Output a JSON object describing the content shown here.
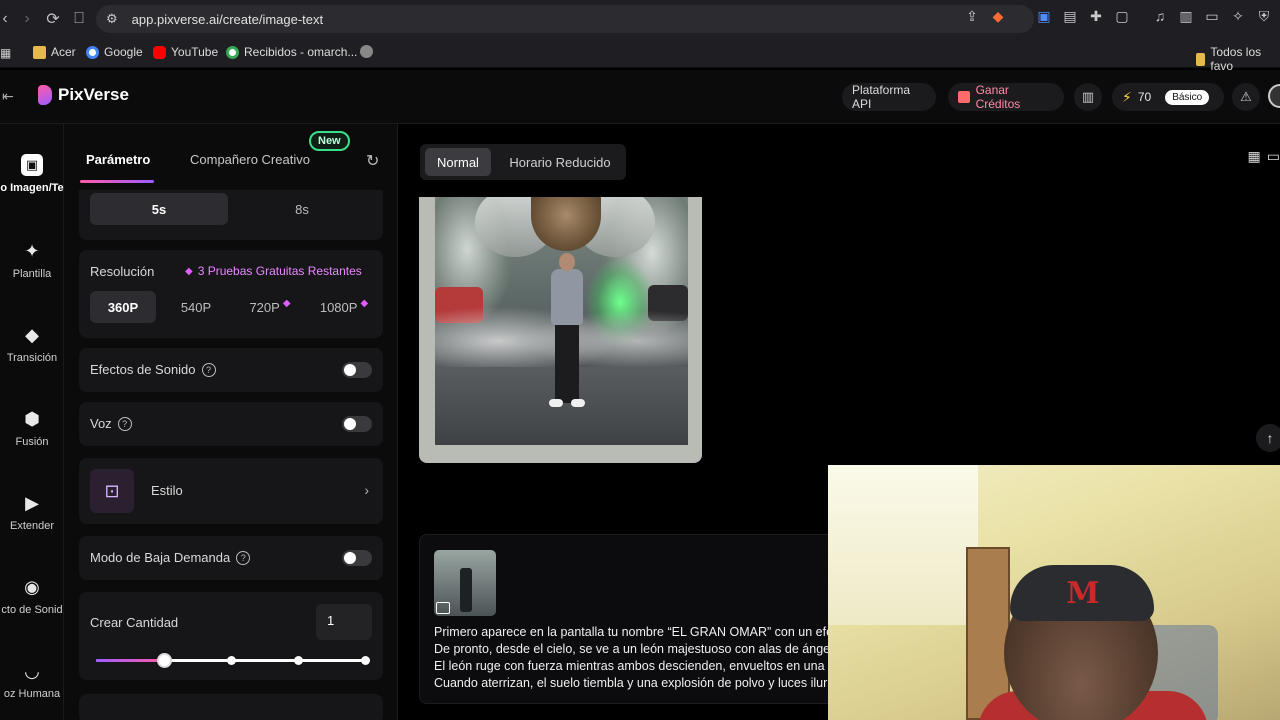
{
  "browser": {
    "url": "app.pixverse.ai/create/image-text",
    "bookmarks": [
      "Acer",
      "Google",
      "YouTube",
      "Recibidos - omarch...",
      "Todos los favo"
    ],
    "brave_badge": "1"
  },
  "header": {
    "brand": "PixVerse",
    "api_label": "Plataforma API",
    "credits_label": "Ganar Créditos",
    "points": "70",
    "plan": "Básico"
  },
  "rail": {
    "items": [
      {
        "label": "o Imagen/Te",
        "icon": "image-icon"
      },
      {
        "label": "Plantilla",
        "icon": "sparkle-icon"
      },
      {
        "label": "Transición",
        "icon": "transition-icon"
      },
      {
        "label": "Fusión",
        "icon": "cube-icon"
      },
      {
        "label": "Extender",
        "icon": "extend-icon"
      },
      {
        "label": "cto de Sonid",
        "icon": "sound-icon"
      },
      {
        "label": "oz Humana",
        "icon": "lips-icon"
      }
    ]
  },
  "panel": {
    "tabs": [
      "Parámetro",
      "Compañero Creativo"
    ],
    "new_badge": "New",
    "duration": {
      "options": [
        "5s",
        "8s"
      ],
      "selected": "5s"
    },
    "resolution": {
      "label": "Resolución",
      "trial": "3 Pruebas Gratuitas Restantes",
      "options": [
        "360P",
        "540P",
        "720P",
        "1080P"
      ],
      "selected": "360P"
    },
    "sound_effects": {
      "label": "Efectos de Sonido",
      "help": "?",
      "on": false
    },
    "voice": {
      "label": "Voz",
      "help": "?",
      "on": false
    },
    "style": {
      "label": "Estilo"
    },
    "low_demand": {
      "label": "Modo de Baja Demanda",
      "help": "?",
      "on": false
    },
    "quantity": {
      "label": "Crear Cantidad",
      "value": "1",
      "slider_fraction": 0.25
    }
  },
  "main": {
    "modes": [
      "Normal",
      "Horario Reducido"
    ],
    "selected_mode": "Normal",
    "prompt_lines": [
      "Primero aparece en la pantalla tu nombre “EL GRAN OMAR” con un efe",
      "De pronto, desde el cielo, se ve a un león majestuoso con alas de ánge",
      "El león ruge con fuerza mientras ambos descienden, envueltos en una",
      "Cuando aterrizan, el suelo tiembla y una explosión de polvo y luces ilur"
    ]
  }
}
